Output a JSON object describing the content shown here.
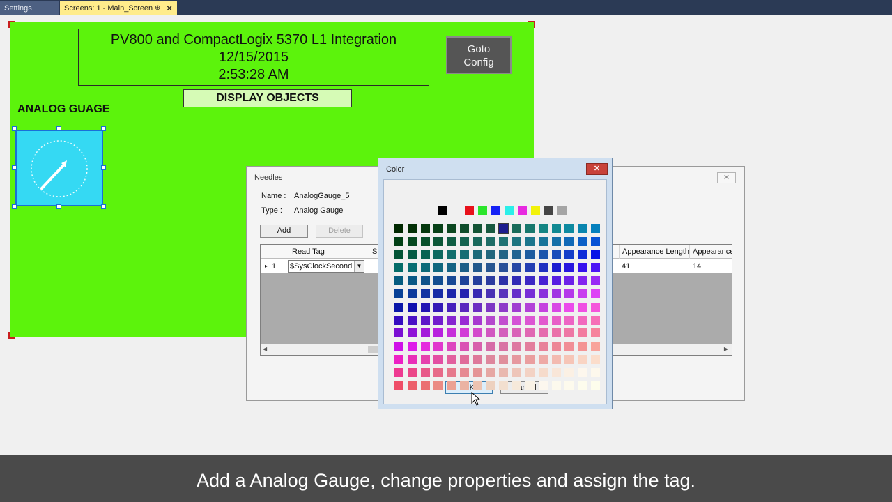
{
  "tabs": {
    "settings_label": "Settings",
    "main_label": "Screens: 1 - Main_Screen",
    "pin_glyph": "⊕",
    "close_glyph": "✕"
  },
  "screen": {
    "background_color": "#5cf30c",
    "title_line1": "PV800 and CompactLogix 5370 L1 Integration",
    "title_line2": "12/15/2015",
    "title_line3": "2:53:28 AM",
    "goto_button_line1": "Goto",
    "goto_button_line2": "Config",
    "display_objects_label": "DISPLAY OBJECTS",
    "gauge_section_label": "ANALOG GUAGE",
    "gauge_color": "#35d9f3",
    "gauge_icon": "gauge-icon"
  },
  "needles_dialog": {
    "title": "Needles",
    "close_glyph": "✕",
    "name_label": "Name :",
    "name_value": "AnalogGauge_5",
    "type_label": "Type :",
    "type_value": "Analog Gauge",
    "add_label": "Add",
    "delete_label": "Delete",
    "columns": [
      "Read Tag",
      "Sh",
      "Appearance Length",
      "Appearance"
    ],
    "rows": [
      {
        "indicator": "▸",
        "index": "1",
        "read_tag": "$SysClockSecond",
        "appearance_length": "41",
        "appearance": "14"
      }
    ]
  },
  "color_dialog": {
    "title": "Color",
    "close_glyph": "✕",
    "ok_label": "OK",
    "cancel_label": "Cancel",
    "basic_colors": [
      "#000000",
      "#f0f0f0",
      "#e8111b",
      "#2ce52c",
      "#1522f5",
      "#2befe9",
      "#e72ae0",
      "#f2f20a",
      "#454545",
      "#a5a5a5"
    ],
    "selected_color": "#1c1c8e"
  },
  "subtitle": "Add a Analog Gauge, change properties and assign the tag."
}
